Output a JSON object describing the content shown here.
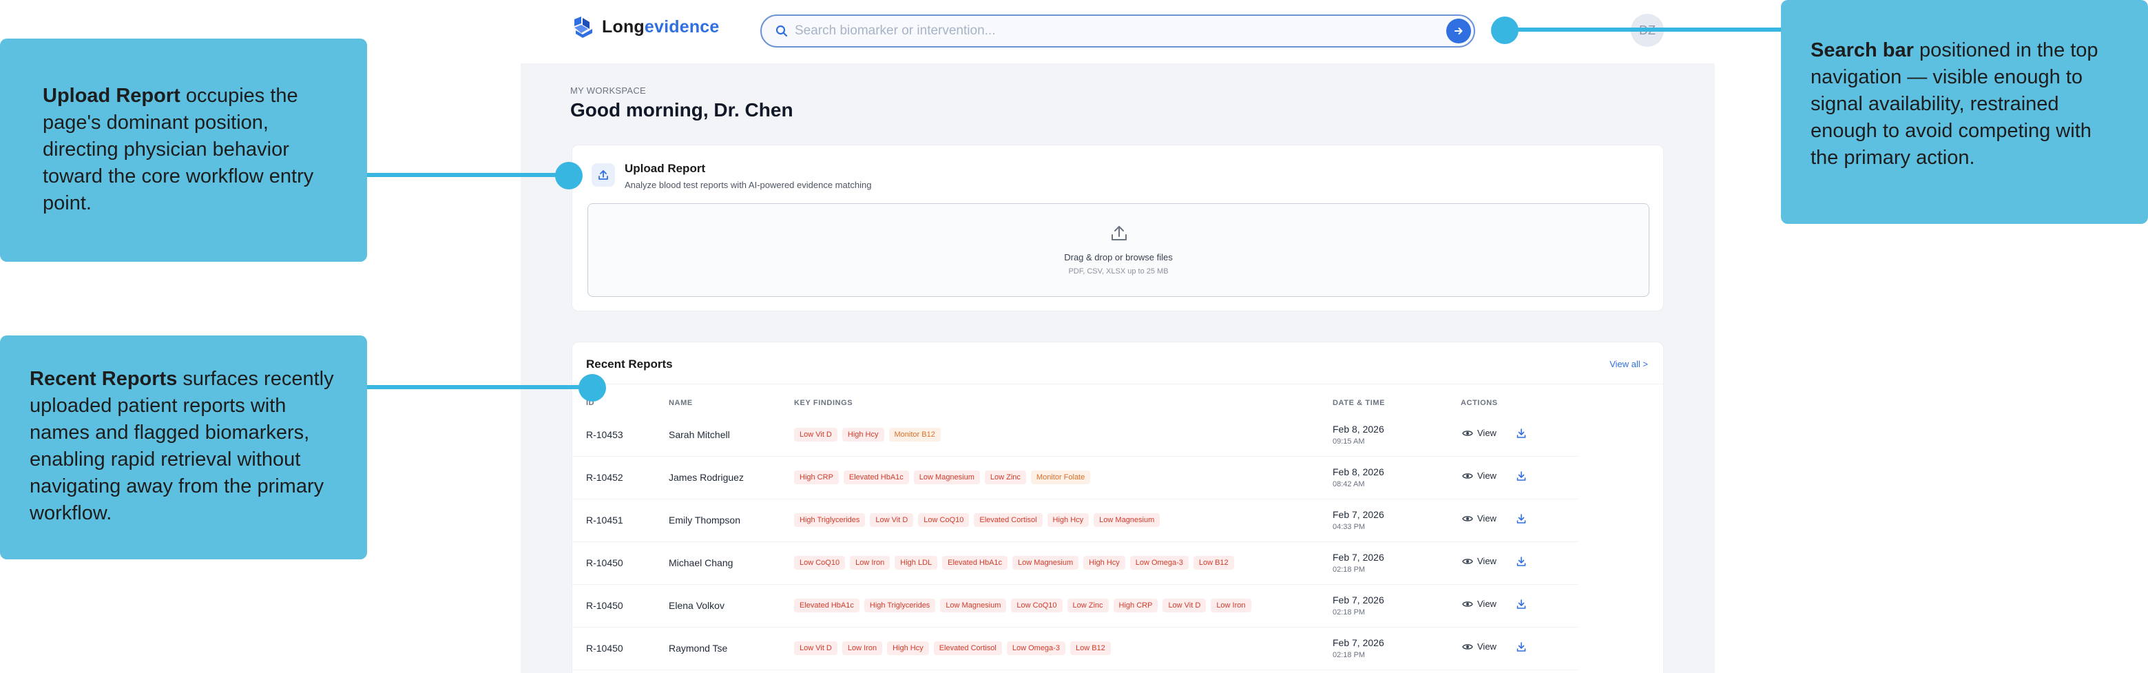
{
  "app": {
    "logo_part1": "Long",
    "logo_part2": "evidence",
    "brand_color": "#2f6fe0"
  },
  "search": {
    "placeholder": "Search biomarker or intervention..."
  },
  "avatar": {
    "initials": "DZ"
  },
  "workspace": {
    "eyebrow": "MY WORKSPACE",
    "greeting": "Good morning, Dr. Chen"
  },
  "upload": {
    "title": "Upload Report",
    "subtitle": "Analyze blood test reports with AI-powered evidence matching",
    "drop_main": "Drag & drop or browse files",
    "drop_sub": "PDF, CSV, XLSX up to 25 MB"
  },
  "reports": {
    "title": "Recent Reports",
    "view_all": "View all >",
    "columns": {
      "id": "ID",
      "name": "NAME",
      "findings": "KEY FINDINGS",
      "date": "DATE & TIME",
      "actions": "ACTIONS"
    },
    "view_label": "View",
    "rows": [
      {
        "id": "R-10453",
        "name": "Sarah Mitchell",
        "tags": [
          "Low Vit D",
          "High Hcy",
          "Monitor B12"
        ],
        "date": "Feb 8, 2026",
        "time": "09:15 AM"
      },
      {
        "id": "R-10452",
        "name": "James Rodriguez",
        "tags": [
          "High CRP",
          "Elevated HbA1c",
          "Low Magnesium",
          "Low Zinc",
          "Monitor Folate"
        ],
        "date": "Feb 8, 2026",
        "time": "08:42 AM"
      },
      {
        "id": "R-10451",
        "name": "Emily Thompson",
        "tags": [
          "High Triglycerides",
          "Low Vit D",
          "Low CoQ10",
          "Elevated Cortisol",
          "High Hcy",
          "Low Magnesium"
        ],
        "date": "Feb 7, 2026",
        "time": "04:33 PM"
      },
      {
        "id": "R-10450",
        "name": "Michael Chang",
        "tags": [
          "Low CoQ10",
          "Low Iron",
          "High LDL",
          "Elevated HbA1c",
          "Low Magnesium",
          "High Hcy",
          "Low Omega-3",
          "Low B12"
        ],
        "date": "Feb 7, 2026",
        "time": "02:18 PM"
      },
      {
        "id": "R-10450",
        "name": "Elena Volkov",
        "tags": [
          "Elevated HbA1c",
          "High Triglycerides",
          "Low Magnesium",
          "Low CoQ10",
          "Low Zinc",
          "High CRP",
          "Low Vit D",
          "Low Iron"
        ],
        "date": "Feb 7, 2026",
        "time": "02:18 PM"
      },
      {
        "id": "R-10450",
        "name": "Raymond Tse",
        "tags": [
          "Low Vit D",
          "Low Iron",
          "High Hcy",
          "Elevated Cortisol",
          "Low Omega-3",
          "Low B12"
        ],
        "date": "Feb 7, 2026",
        "time": "02:18 PM"
      }
    ]
  },
  "annotations": {
    "upload": {
      "bold": "Upload Report",
      "text": " occupies the page's dominant position, directing physician behavior toward the core workflow entry point."
    },
    "recent": {
      "bold": "Recent Reports",
      "text": " surfaces recently uploaded patient reports with names and flagged biomarkers, enabling rapid retrieval without navigating away from the primary workflow."
    },
    "search": {
      "bold": "Search bar",
      "text": " positioned in the top navigation — visible enough to signal availability, restrained enough to avoid competing with the primary action."
    },
    "callout_color": "#5ec0e0",
    "connector_color": "#38b6e2"
  }
}
